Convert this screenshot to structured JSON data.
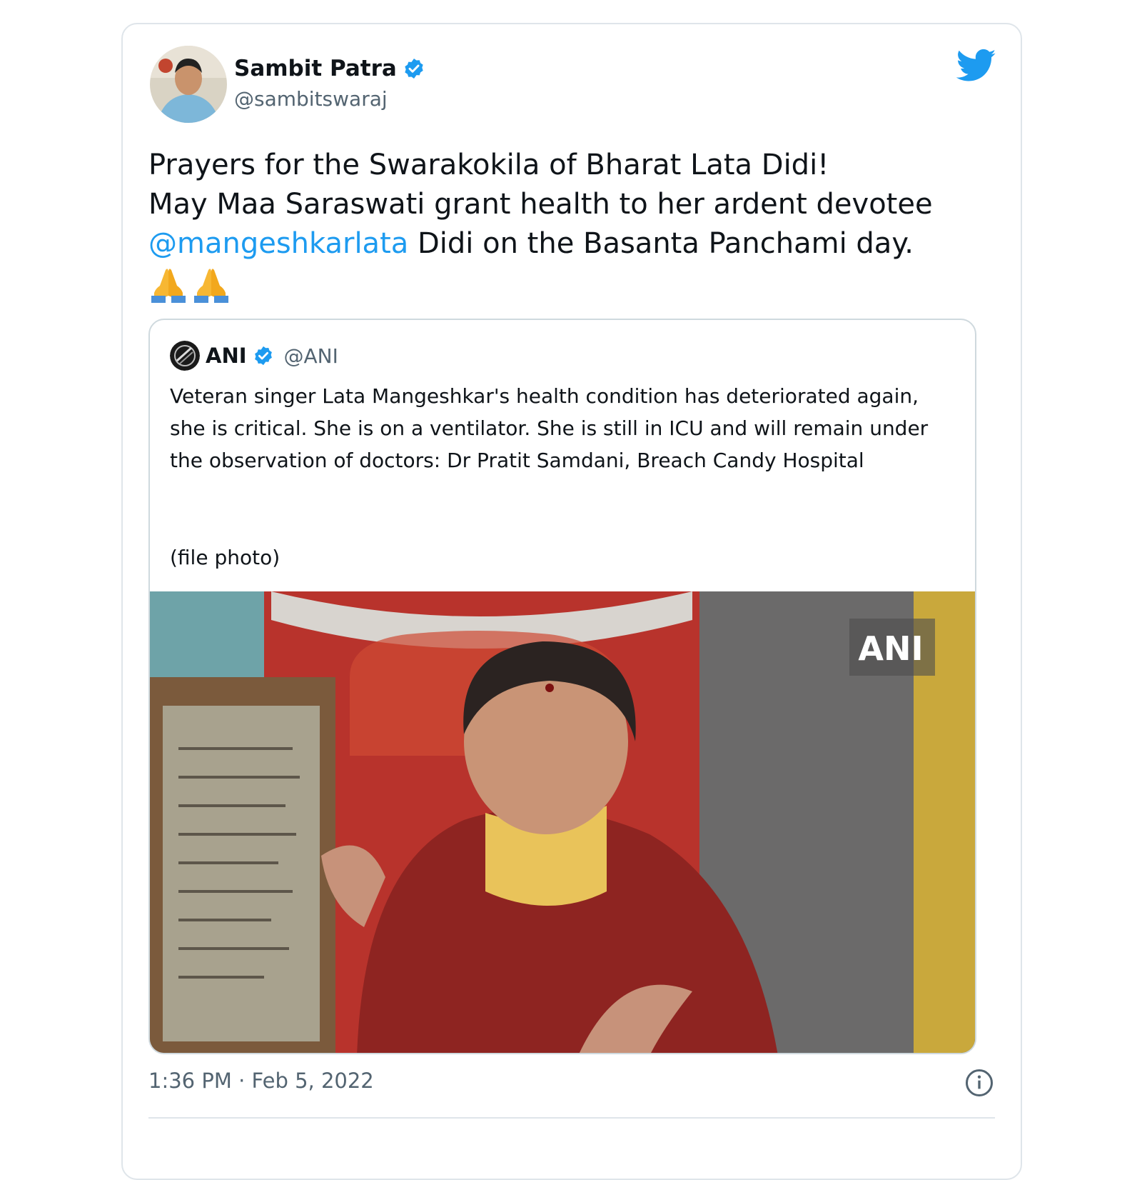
{
  "tweet": {
    "author": {
      "display_name": "Sambit Patra",
      "handle": "@sambitswaraj",
      "verified_icon": "verified-badge-icon"
    },
    "platform_icon": "twitter-bird-icon",
    "text_line1": "Prayers for the Swarakokila of Bharat Lata Didi!",
    "text_line2": "May Maa Saraswati grant health to her ardent devotee",
    "mention": "@mangeshkarlata",
    "text_line3": " Didi on the Basanta Panchami day.",
    "emojis": [
      "🙏",
      "🙏"
    ],
    "timestamp": "1:36 PM · Feb 5, 2022",
    "info_icon": "info-icon"
  },
  "quoted_tweet": {
    "author": {
      "display_name": "ANI",
      "handle": "@ANI",
      "verified_icon": "verified-badge-icon"
    },
    "text": "Veteran singer Lata Mangeshkar's health condition has deteriorated again, she is critical. She is on a ventilator. She is still in ICU and will remain under the observation of doctors: Dr Pratit Samdani, Breach Candy Hospital",
    "note": "(file photo)",
    "media_watermark": "ANI"
  },
  "colors": {
    "accent": "#1d9bf0",
    "text": "#0f1419",
    "muted": "#536471",
    "border": "#cfd9de"
  }
}
